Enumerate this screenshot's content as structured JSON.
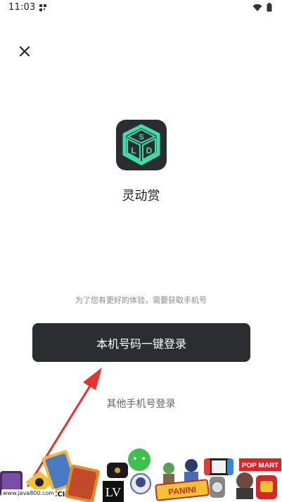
{
  "status_bar": {
    "time": "11:03"
  },
  "close_button": {
    "icon": "close-icon"
  },
  "app": {
    "name": "灵动赏",
    "logo_letters": [
      "S",
      "L",
      "D"
    ]
  },
  "login": {
    "hint": "为了您有更好的体验，需要获取手机号",
    "one_click_label": "本机号码一键登录",
    "other_label": "其他手机号登录"
  },
  "banner": {
    "watermark": "www.java800.com",
    "brand_texts": [
      "POP MART",
      "PANINI",
      "CCI"
    ]
  },
  "colors": {
    "button_bg": "#2b2d30",
    "logo_bg": "#2a2d31",
    "logo_accent": "#3ee0a8",
    "arrow": "#e5322d"
  }
}
